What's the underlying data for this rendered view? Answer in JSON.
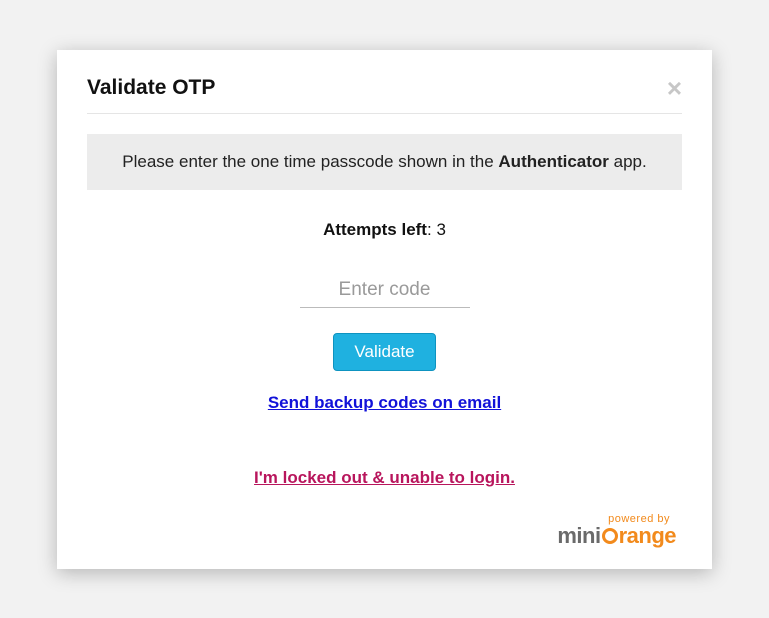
{
  "dialog": {
    "title": "Validate OTP",
    "close_label": "×"
  },
  "instruction": {
    "prefix": "Please enter the one time passcode shown in the ",
    "bold": "Authenticator",
    "suffix": " app."
  },
  "attempts": {
    "label": "Attempts left",
    "separator": ": ",
    "value": "3"
  },
  "input": {
    "placeholder": "Enter code",
    "value": ""
  },
  "buttons": {
    "validate": "Validate"
  },
  "links": {
    "backup": "Send backup codes on email",
    "locked": "I'm locked out & unable to login."
  },
  "footer": {
    "powered_by": "powered by",
    "brand_prefix": "mini",
    "brand_suffix": "range"
  }
}
